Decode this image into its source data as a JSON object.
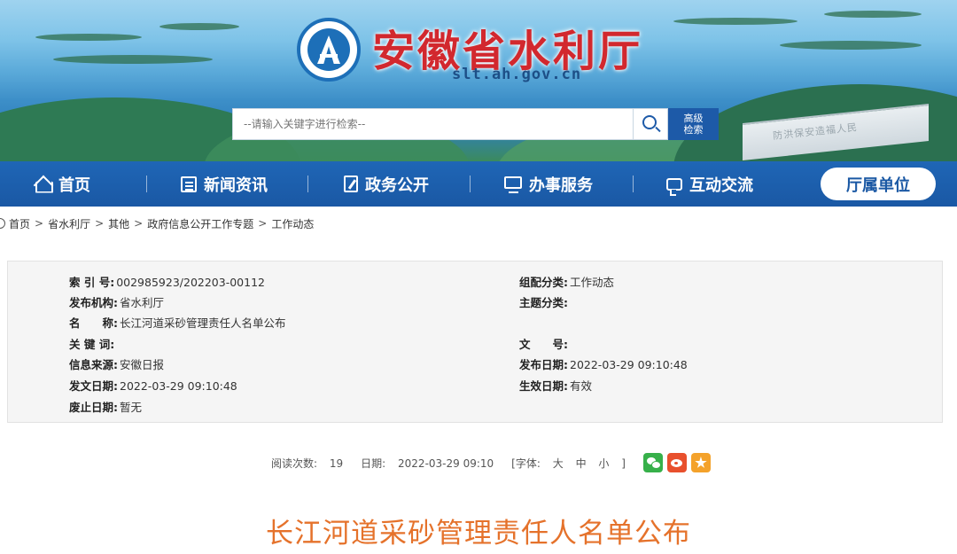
{
  "header": {
    "site_title": "安徽省水利厅",
    "site_domain": "slt.ah.gov.cn",
    "search_placeholder": "--请输入关键字进行检索--",
    "advanced_search_line1": "高级",
    "advanced_search_line2": "检索",
    "banner_text": "防洪保安造福人民"
  },
  "nav": {
    "items": [
      {
        "label": "首页",
        "icon": "home-icon"
      },
      {
        "label": "新闻资讯",
        "icon": "news-icon"
      },
      {
        "label": "政务公开",
        "icon": "document-edit-icon"
      },
      {
        "label": "办事服务",
        "icon": "monitor-icon"
      },
      {
        "label": "互动交流",
        "icon": "chat-icon"
      }
    ],
    "active_label": "厅属单位"
  },
  "breadcrumb": [
    "首页",
    "省水利厅",
    "其他",
    "政府信息公开工作专题",
    "工作动态"
  ],
  "breadcrumb_sep": ">",
  "meta": {
    "index_no_key": "索 引 号:",
    "index_no": "002985923/202203-00112",
    "group_key": "组配分类:",
    "group": "工作动态",
    "publisher_key": "发布机构:",
    "publisher": "省水利厅",
    "topic_key": "主题分类:",
    "topic": "",
    "name_key": "名　　称:",
    "name": "长江河道采砂管理责任人名单公布",
    "keywords_key": "关 键 词:",
    "keywords": "",
    "doc_no_key": "文　　号:",
    "doc_no": "",
    "source_key": "信息来源:",
    "source": "安徽日报",
    "pub_date_key": "发布日期:",
    "pub_date": "2022-03-29 09:10:48",
    "issue_date_key": "发文日期:",
    "issue_date": "2022-03-29 09:10:48",
    "effective_key": "生效日期:",
    "effective": "有效",
    "expiry_key": "废止日期:",
    "expiry": "暂无"
  },
  "article": {
    "reads_label": "阅读次数:",
    "reads": "19",
    "date_label": "日期:",
    "date": "2022-03-29 09:10",
    "font_open": "[字体:",
    "font_large": "大",
    "font_medium": "中",
    "font_small": "小",
    "font_close": "]",
    "share": [
      "wechat-icon",
      "weibo-icon",
      "favorite-star-icon"
    ],
    "title": "长江河道采砂管理责任人名单公布"
  },
  "colors": {
    "brand_blue": "#1a58a4",
    "title_red": "#d2282e",
    "article_title_orange": "#e5722b",
    "wechat_green": "#37b04a",
    "weibo_red": "#e8502d",
    "star_orange": "#f4a22b"
  }
}
